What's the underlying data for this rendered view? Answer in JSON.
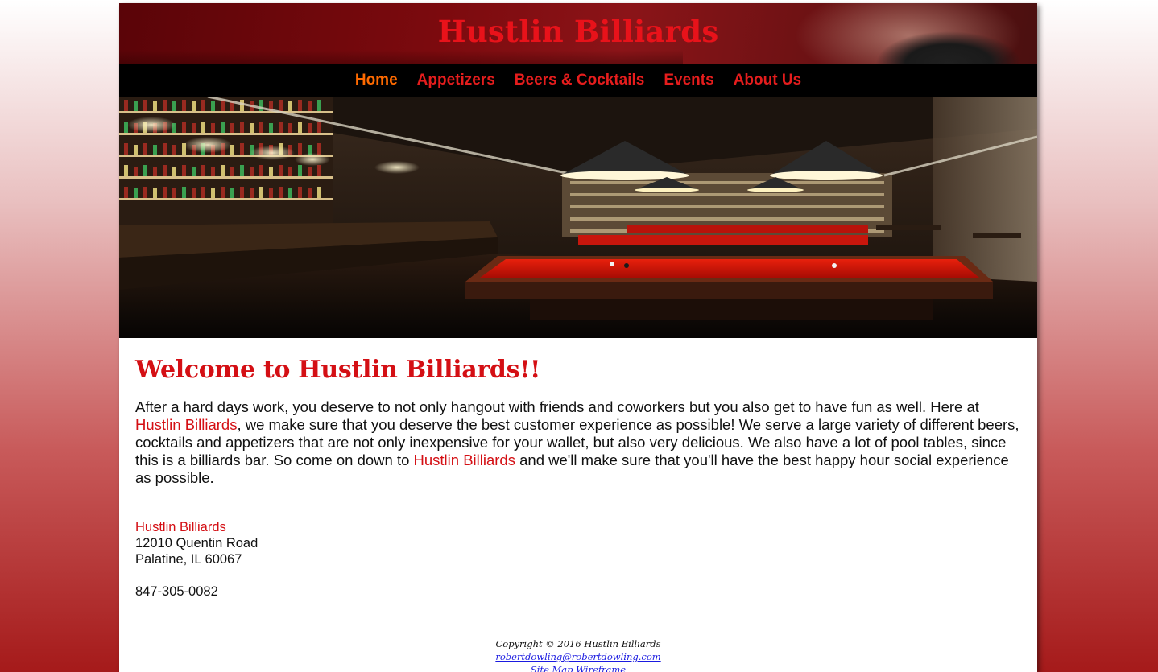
{
  "site": {
    "title": "Hustlin Billiards"
  },
  "nav": {
    "items": [
      {
        "label": "Home",
        "active": true
      },
      {
        "label": "Appetizers",
        "active": false
      },
      {
        "label": "Beers & Cocktails",
        "active": false
      },
      {
        "label": "Events",
        "active": false
      },
      {
        "label": "About Us",
        "active": false
      }
    ]
  },
  "main": {
    "heading": "Welcome to Hustlin Billiards!!",
    "intro": {
      "part1": "After a hard days work, you deserve to not only hangout with friends and coworkers but you also get to have fun as well. Here at ",
      "name1": "Hustlin Billiards",
      "part2": ", we make sure that you deserve the best customer experience as possible! We serve a large variety of different beers, cocktails and appetizers that are not only inexpensive for your wallet, but also very delicious. We also have a lot of pool tables, since this is a billiards bar. So come on down to ",
      "name2": "Hustlin Billiards",
      "part3": " and we'll make sure that you'll have the best happy hour social experience as possible."
    },
    "address": {
      "name": "Hustlin Billiards",
      "street": "12010 Quentin Road",
      "city": "Palatine, IL 60067"
    },
    "phone": "847-305-0082"
  },
  "footer": {
    "copyright": "Copyright © 2016 Hustlin Billiards",
    "email": "robertdowling@robertdowling.com",
    "sitemap": "Site Map Wireframe"
  },
  "colors": {
    "accent_red": "#d40f14",
    "nav_active": "#ff6a00",
    "nav_link": "#e51d1d",
    "nav_bg": "#000000"
  }
}
